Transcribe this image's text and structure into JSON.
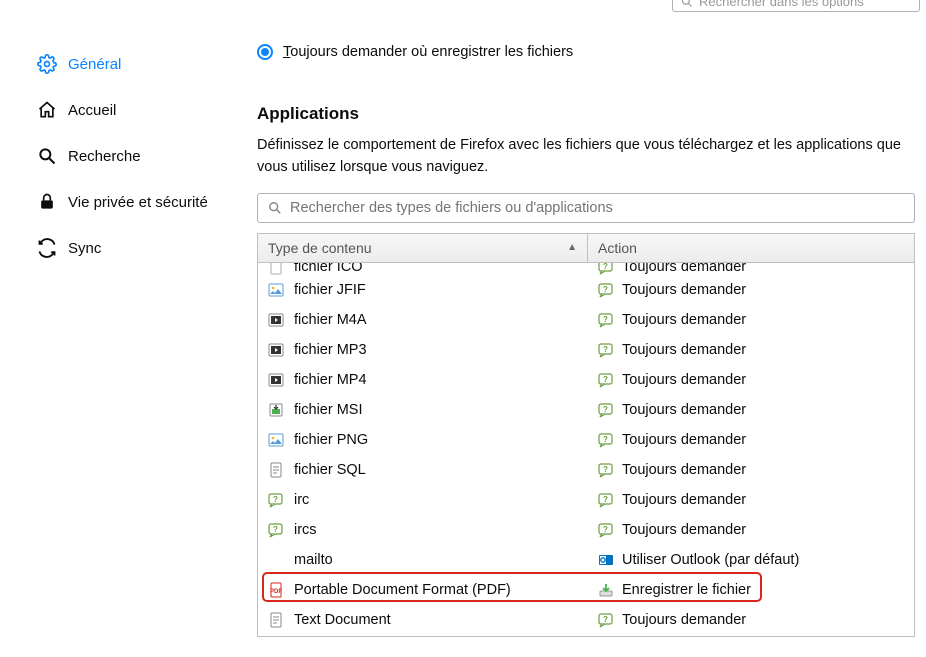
{
  "topSearch": {
    "placeholder": "Rechercher dans les options"
  },
  "sidebar": {
    "items": [
      {
        "label": "Général",
        "icon": "gear-icon",
        "active": true
      },
      {
        "label": "Accueil",
        "icon": "home-icon"
      },
      {
        "label": "Recherche",
        "icon": "search-icon"
      },
      {
        "label": "Vie privée et sécurité",
        "icon": "lock-icon"
      },
      {
        "label": "Sync",
        "icon": "sync-icon"
      }
    ]
  },
  "radio": {
    "label_prefix": "T",
    "label_rest": "oujours demander où enregistrer les fichiers"
  },
  "applications": {
    "title": "Applications",
    "description": "Définissez le comportement de Firefox avec les fichiers que vous téléchargez et les applications que vous utilisez lorsque vous naviguez.",
    "search_placeholder": "Rechercher des types de fichiers ou d'applications",
    "headers": {
      "content_type": "Type de contenu",
      "action": "Action"
    },
    "rows": [
      {
        "type": "fichier ICO",
        "icon": "generic-file",
        "action": "Toujours demander",
        "action_icon": "ask",
        "cut": true
      },
      {
        "type": "fichier JFIF",
        "icon": "image-file",
        "action": "Toujours demander",
        "action_icon": "ask"
      },
      {
        "type": "fichier M4A",
        "icon": "media-file",
        "action": "Toujours demander",
        "action_icon": "ask"
      },
      {
        "type": "fichier MP3",
        "icon": "media-file",
        "action": "Toujours demander",
        "action_icon": "ask"
      },
      {
        "type": "fichier MP4",
        "icon": "media-file",
        "action": "Toujours demander",
        "action_icon": "ask"
      },
      {
        "type": "fichier MSI",
        "icon": "installer-file",
        "action": "Toujours demander",
        "action_icon": "ask"
      },
      {
        "type": "fichier PNG",
        "icon": "image-file",
        "action": "Toujours demander",
        "action_icon": "ask"
      },
      {
        "type": "fichier SQL",
        "icon": "text-file",
        "action": "Toujours demander",
        "action_icon": "ask"
      },
      {
        "type": "irc",
        "icon": "ask",
        "action": "Toujours demander",
        "action_icon": "ask"
      },
      {
        "type": "ircs",
        "icon": "ask",
        "action": "Toujours demander",
        "action_icon": "ask"
      },
      {
        "type": "mailto",
        "icon": "none",
        "action": "Utiliser Outlook (par défaut)",
        "action_icon": "outlook"
      },
      {
        "type": "Portable Document Format (PDF)",
        "icon": "pdf-file",
        "action": "Enregistrer le fichier",
        "action_icon": "save",
        "highlight": true
      },
      {
        "type": "Text Document",
        "icon": "text-file",
        "action": "Toujours demander",
        "action_icon": "ask"
      }
    ]
  }
}
